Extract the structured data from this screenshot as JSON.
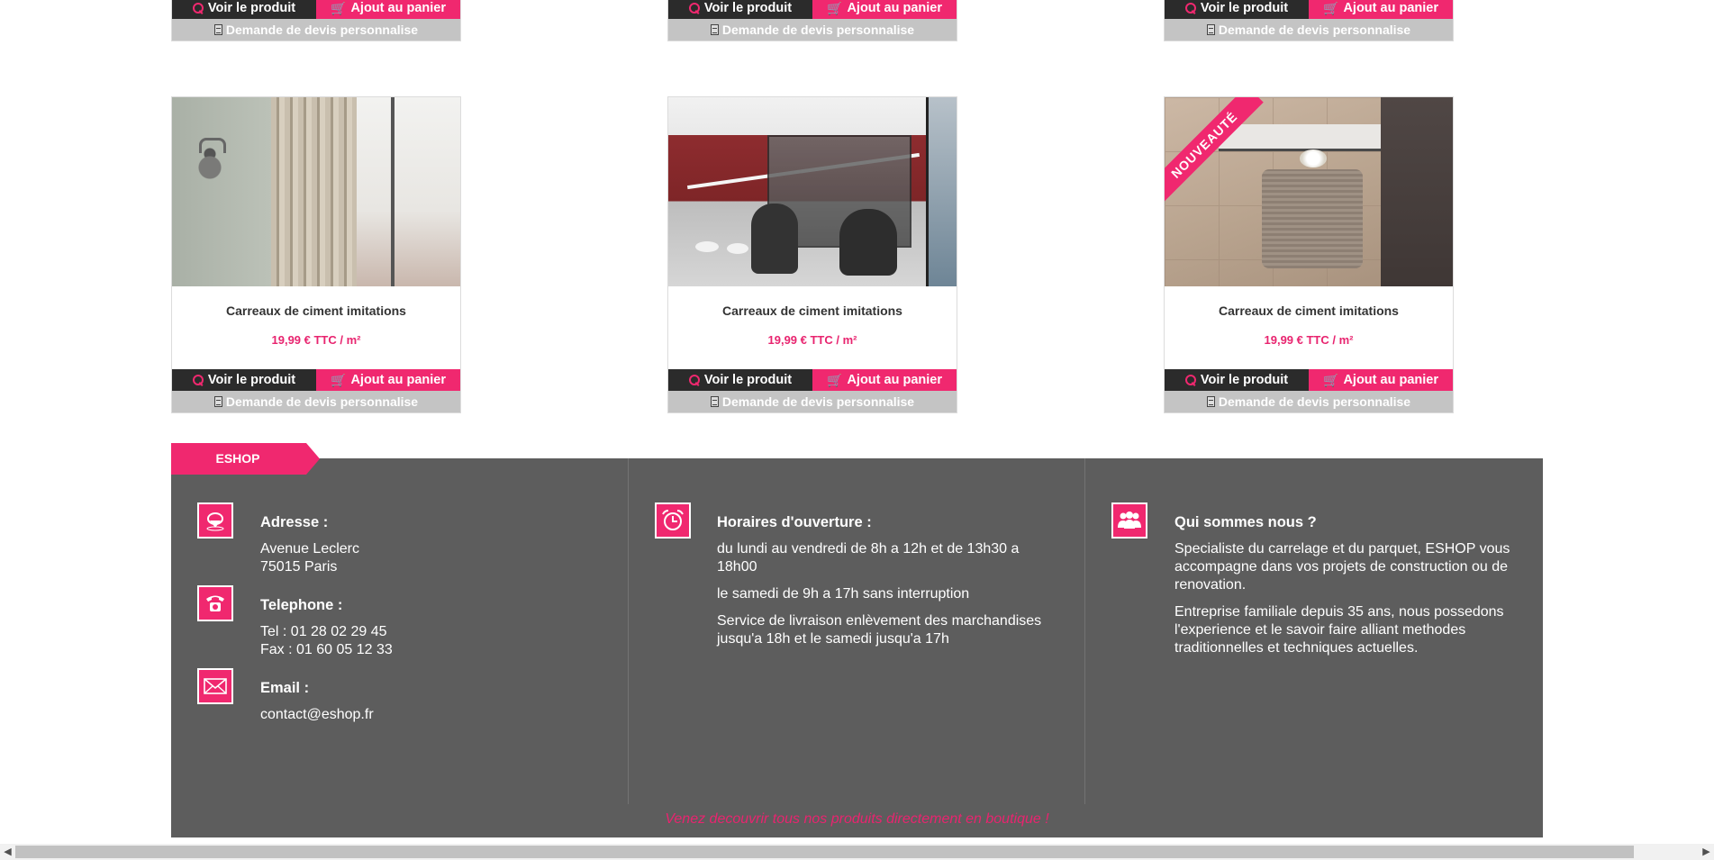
{
  "buttons": {
    "view": "Voir le produit",
    "cart": "Ajout au panier",
    "quote": "Demande de devis personnalise"
  },
  "products_top_row": [
    {
      "view": "Voir le produit",
      "cart": "Ajout au panier",
      "quote": "Demande de devis personnalise"
    },
    {
      "view": "Voir le produit",
      "cart": "Ajout au panier",
      "quote": "Demande de devis personnalise"
    },
    {
      "view": "Voir le produit",
      "cart": "Ajout au panier",
      "quote": "Demande de devis personnalise"
    }
  ],
  "products": [
    {
      "title": "Carreaux de ciment imitations",
      "price": "19,99 € TTC / m²",
      "badge": ""
    },
    {
      "title": "Carreaux de ciment imitations",
      "price": "19,99 € TTC / m²",
      "badge": ""
    },
    {
      "title": "Carreaux de ciment imitations",
      "price": "19,99 € TTC / m²",
      "badge": "NOUVEAUTÉ"
    }
  ],
  "footer": {
    "tab_label": "ESHOP",
    "address": {
      "heading": "Adresse :",
      "line1": "Avenue Leclerc",
      "line2": "75015 Paris",
      "icon": "location-pin-icon"
    },
    "telephone": {
      "heading": "Telephone :",
      "line1": "Tel : 01 28 02 29 45",
      "line2": "Fax : 01 60 05 12 33",
      "icon": "phone-icon"
    },
    "email": {
      "heading": "Email :",
      "value": "contact@eshop.fr",
      "icon": "envelope-icon"
    },
    "hours": {
      "heading": "Horaires d'ouverture :",
      "p1": "du lundi au vendredi de 8h a 12h et de 13h30 a 18h00",
      "p2": "le samedi de 9h a 17h sans interruption",
      "p3": "Service de livraison enlèvement des marchandises jusqu'a 18h et le samedi jusqu'a 17h",
      "icon": "alarm-clock-icon"
    },
    "about": {
      "heading": "Qui sommes nous ?",
      "p1": "Specialiste du carrelage et du parquet, ESHOP vous accompagne dans vos projets de construction ou de renovation.",
      "p2": "Entreprise familiale depuis 35 ans, nous possedons l'experience et le savoir faire alliant methodes traditionnelles et techniques actuelles.",
      "icon": "team-icon"
    },
    "note": "Venez decouvrir tous nos produits directement en boutique !"
  },
  "colors": {
    "accent": "#f0286f",
    "dark": "#2b2b2b",
    "footer_bg": "#5d5d5d",
    "quote_bg": "#c4c4c4"
  }
}
